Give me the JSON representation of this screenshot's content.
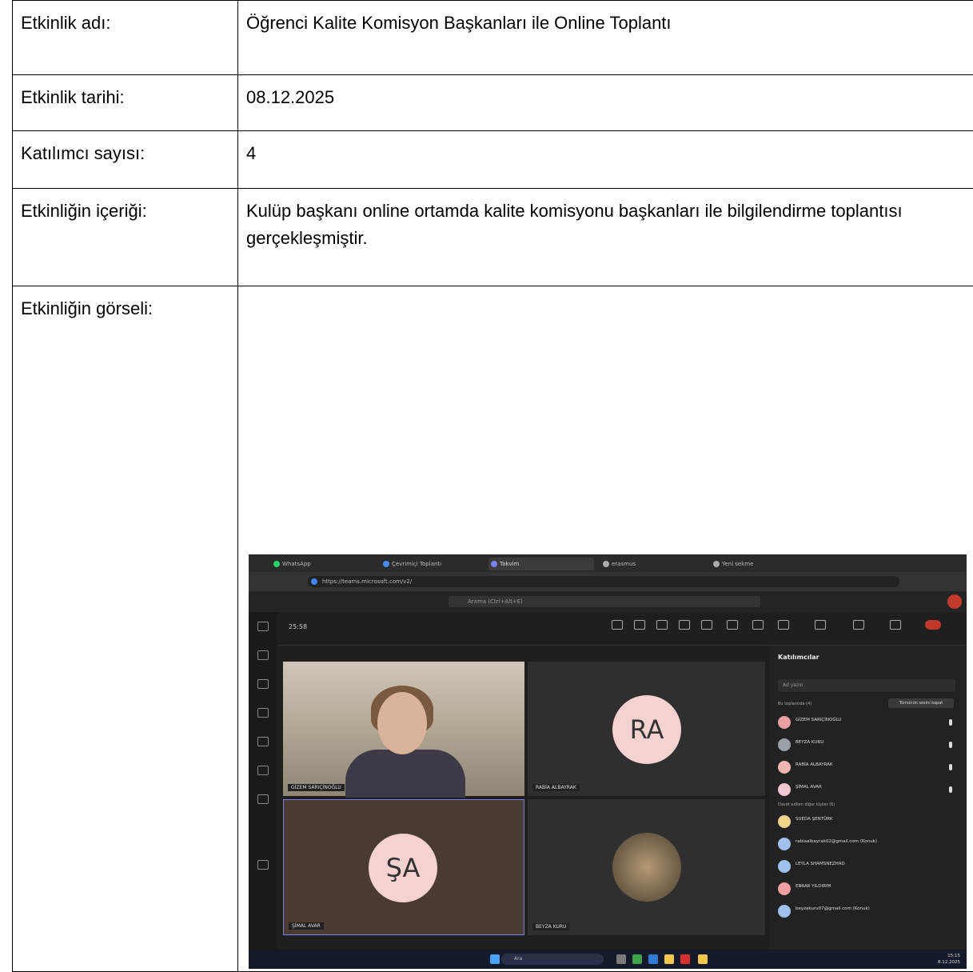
{
  "form": {
    "rows": [
      {
        "label": "Etkinlik adı:",
        "value": "Öğrenci Kalite Komisyon Başkanları ile Online Toplantı"
      },
      {
        "label": "Etkinlik tarihi:",
        "value": "08.12.2025"
      },
      {
        "label": "Katılımcı sayısı:",
        "value": "4"
      },
      {
        "label": "Etkinliğin içeriği:",
        "value": "Kulüp başkanı online ortamda kalite komisyonu başkanları ile bilgilendirme toplantısı gerçekleşmiştir."
      },
      {
        "label": "Etkinliğin görseli:",
        "value": ""
      }
    ]
  },
  "screenshot": {
    "tabs": [
      "WhatsApp",
      "Çevrimiçi Toplantı",
      "Takvim",
      "erasmus",
      "Yeni sekme"
    ],
    "url": "https://teams.microsoft.com/v2/",
    "search_placeholder": "Arama (Ctrl+Alt+E)",
    "timer": "25:58",
    "tiles": [
      {
        "name": "GİZEM SARIÇİNOĞLU",
        "initials": ""
      },
      {
        "name": "RABİA ALBAYRAK",
        "initials": "RA"
      },
      {
        "name": "ŞİMAL AVAR",
        "initials": "ŞA"
      },
      {
        "name": "BEYZA KURU",
        "initials": ""
      }
    ],
    "panel": {
      "title": "Katılımcılar",
      "search_placeholder": "Ad yazın",
      "in_meeting_label": "Bu toplantıda (4)",
      "mute_all_label": "Tümünün sesini kapat",
      "others_label": "Davet edilen diğer kişiler (6)",
      "participants": [
        {
          "name": "GİZEM SARIÇİNOĞLU",
          "color": "#e8a0a0"
        },
        {
          "name": "BEYZA KURU",
          "color": "#9aa0a6"
        },
        {
          "name": "RABİA ALBAYRAK",
          "color": "#f0b7b0"
        },
        {
          "name": "ŞİMAL AVAR",
          "color": "#f3c7d2"
        },
        {
          "name": "SUEDA ŞENTÜRK",
          "color": "#f2d38a"
        },
        {
          "name": "rabiaalbayrak02@gmail.com (Konuk)",
          "color": "#9fc1ec"
        },
        {
          "name": "LEYLA SHAMSNEZHAD",
          "color": "#9fc1ec"
        },
        {
          "name": "EBRAR YILDIRIM",
          "color": "#f0a0a0"
        },
        {
          "name": "beyzakuru07@gmail.com (Konuk)",
          "color": "#9fc1ec"
        }
      ]
    },
    "taskbar": {
      "search": "Ara",
      "time": "15:15",
      "date": "8.12.2025"
    }
  }
}
